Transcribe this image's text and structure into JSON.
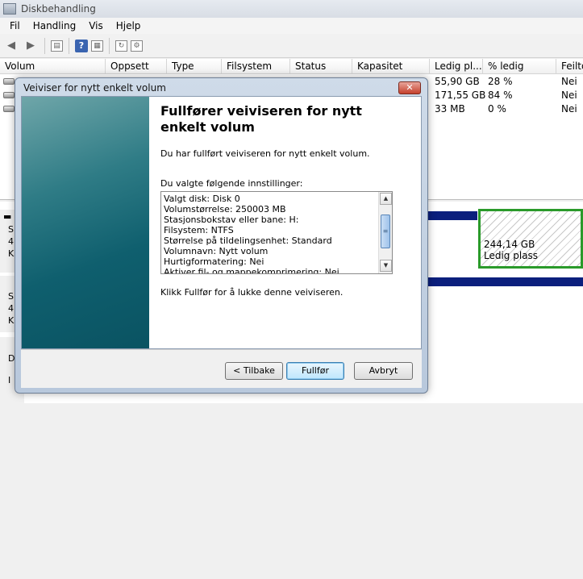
{
  "app": {
    "title": "Diskbehandling"
  },
  "menu": [
    "Fil",
    "Handling",
    "Vis",
    "Hjelp"
  ],
  "toolbar": {
    "icons": [
      "back-arrow-icon",
      "forward-arrow-icon",
      "up-folder-icon",
      "help-icon",
      "properties-icon",
      "refresh-icon",
      "settings-icon"
    ],
    "help_glyph": "?"
  },
  "volume_list": {
    "columns": [
      "Volum",
      "Oppsett",
      "Type",
      "Filsystem",
      "Status",
      "Kapasitet",
      "Ledig pl...",
      "% ledig",
      "Feilto"
    ],
    "rows": [
      {
        "free": "55,90 GB",
        "pct": "28 %",
        "fault": "Nei"
      },
      {
        "free": "171,55 GB",
        "pct": "84 %",
        "fault": "Nei"
      },
      {
        "free": "33 MB",
        "pct": "0 %",
        "fault": "Nei"
      }
    ]
  },
  "disk_area": {
    "disk_labels_1": [
      "S",
      "4",
      "K"
    ],
    "disk_labels_2": [
      "S",
      "4",
      "K"
    ],
    "disk_labels_3": [
      "D",
      "I"
    ],
    "unallocated": {
      "size": "244,14 GB",
      "label": "Ledig plass"
    }
  },
  "dialog": {
    "title": "Veiviser for nytt enkelt volum",
    "close_glyph": "✕",
    "heading": "Fullfører veiviseren for nytt enkelt volum",
    "intro": "Du har fullført veiviseren for nytt enkelt volum.",
    "settings_label": "Du valgte følgende innstillinger:",
    "settings": [
      "Valgt disk: Disk 0",
      "Volumstørrelse: 250003 MB",
      "Stasjonsbokstav eller bane: H:",
      "Filsystem: NTFS",
      "Størrelse på tildelingsenhet: Standard",
      "Volumnavn: Nytt volum",
      "Hurtigformatering: Nei",
      "Aktiver fil- og mappekomprimering: Nei"
    ],
    "closing": "Klikk Fullfør for å lukke denne veiviseren.",
    "buttons": {
      "back": "< Tilbake",
      "finish": "Fullfør",
      "cancel": "Avbryt"
    }
  }
}
